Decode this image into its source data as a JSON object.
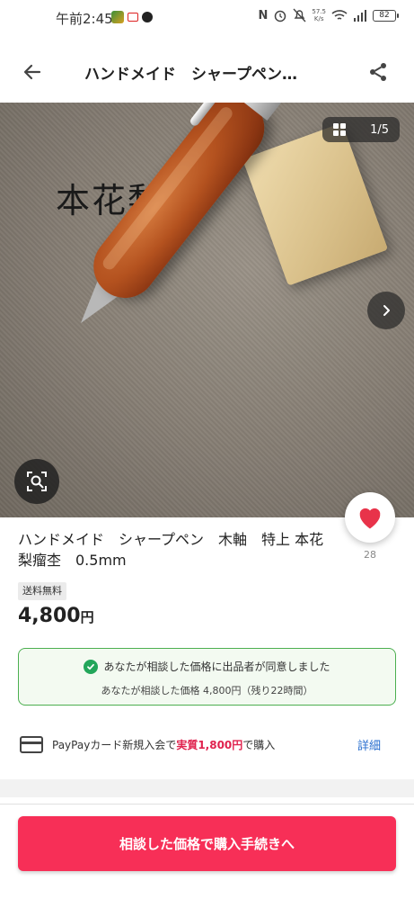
{
  "status_bar": {
    "time": "午前2:45",
    "net_speed": "57.5",
    "net_speed_unit": "K/s",
    "battery": "82"
  },
  "header": {
    "title": "ハンドメイド　シャープペン…"
  },
  "gallery": {
    "caption": "本花梨瘤",
    "counter": "1/5"
  },
  "product": {
    "title": "ハンドメイド　シャープペン　木軸　特上 本花梨瘤杢　0.5mm",
    "shipping_badge": "送料無料",
    "price": "4,800",
    "price_unit": "円",
    "likes": "28"
  },
  "agreement": {
    "message": "あなたが相談した価格に出品者が同意しました",
    "detail": "あなたが相談した価格 4,800円（残り22時間）"
  },
  "paypay": {
    "prefix": "PayPayカード新規入会で",
    "highlight": "実質1,800円",
    "suffix": "で購入",
    "link": "詳細"
  },
  "cta": {
    "label": "相談した価格で購入手続きへ"
  },
  "colors": {
    "accent": "#f72f57",
    "like": "#e8334a",
    "agree_border": "#4caf50",
    "check": "#22a65a",
    "link": "#2a6fcf"
  }
}
